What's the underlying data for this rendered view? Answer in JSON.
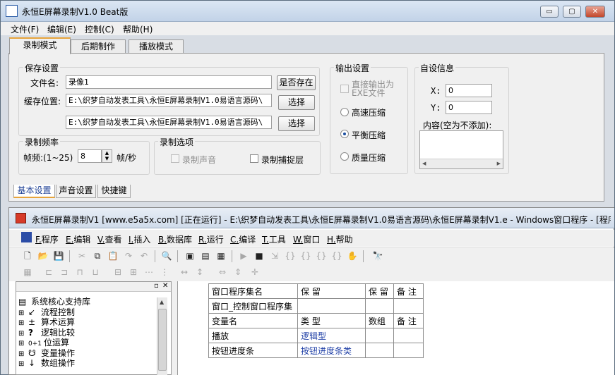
{
  "app": {
    "title": "永恒E屏幕录制V1.0 Beat版",
    "window_buttons": {
      "minimize": "▭",
      "maximize": "▢",
      "close": "✕"
    }
  },
  "menu": [
    "文件(F)",
    "编辑(E)",
    "控制(C)",
    "帮助(H)"
  ],
  "tabs": [
    "录制模式",
    "后期制作",
    "播放模式"
  ],
  "save_settings": {
    "group_label": "保存设置",
    "filename_label": "文件名:",
    "filename_value": "录像1",
    "exists_button": "是否存在",
    "cache_label": "缓存位置:",
    "cache_path_1": "E:\\织梦自动发表工具\\永恒E屏幕录制V1.0易语言源码\\",
    "cache_path_2": "E:\\织梦自动发表工具\\永恒E屏幕录制V1.0易语言源码\\",
    "select_button": "选择"
  },
  "frequency": {
    "group_label": "录制频率",
    "fps_label": "帧频:(1~25)",
    "fps_value": "8",
    "fps_unit": "帧/秒"
  },
  "record_options": {
    "group_label": "录制选项",
    "record_sound": "录制声音",
    "capture_cursor": "录制捕捉层"
  },
  "output_settings": {
    "group_label": "输出设置",
    "direct_exe": "直接输出为EXE文件",
    "fast": "高速压缩",
    "balanced": "平衡压缩",
    "quality": "质量压缩",
    "selected": "平衡压缩"
  },
  "custom_info": {
    "group_label": "自设信息",
    "x_label": "X:",
    "x_value": "0",
    "y_label": "Y:",
    "y_value": "0",
    "content_label": "内容(空为不添加):"
  },
  "sub_tabs": [
    "基本设置",
    "声音设置",
    "快捷键"
  ],
  "ide": {
    "title": "永恒E屏幕录制V1 [www.e5a5x.com] [正在运行] - E:\\织梦自动发表工具\\永恒E屏幕录制V1.0易语言源码\\永恒E屏幕录制V1.e - Windows窗口程序 - [程序",
    "menu": [
      {
        "key": "F.",
        "label": "程序"
      },
      {
        "key": "E.",
        "label": "编辑"
      },
      {
        "key": "V.",
        "label": "查看"
      },
      {
        "key": "I.",
        "label": "插入"
      },
      {
        "key": "B.",
        "label": "数据库"
      },
      {
        "key": "R.",
        "label": "运行"
      },
      {
        "key": "C.",
        "label": "编译"
      },
      {
        "key": "T.",
        "label": "工具"
      },
      {
        "key": "W.",
        "label": "窗口"
      },
      {
        "key": "H.",
        "label": "帮助"
      }
    ],
    "tree": [
      {
        "icon": "▤",
        "label": "系统核心支持库"
      },
      {
        "icon": "↙",
        "label": "流程控制"
      },
      {
        "icon": "±",
        "label": "算术运算"
      },
      {
        "icon": "?",
        "label": "逻辑比较"
      },
      {
        "icon": "0+1",
        "label": "位运算"
      },
      {
        "icon": "☋",
        "label": "变量操作"
      },
      {
        "icon": "↓",
        "label": "数组操作"
      }
    ],
    "pane_buttons": {
      "restore": "▫",
      "close": "✕"
    },
    "table": {
      "row1": [
        "窗口程序集名",
        "保 留",
        "保 留",
        "备 注"
      ],
      "row2": [
        "窗口_控制窗口程序集",
        "",
        "",
        ""
      ],
      "row3": [
        "变量名",
        "类 型",
        "数组",
        "备 注"
      ],
      "row4": [
        "播放",
        "逻辑型",
        "",
        ""
      ],
      "row5": [
        "按钮进度条",
        "按钮进度条类",
        "",
        ""
      ]
    }
  }
}
